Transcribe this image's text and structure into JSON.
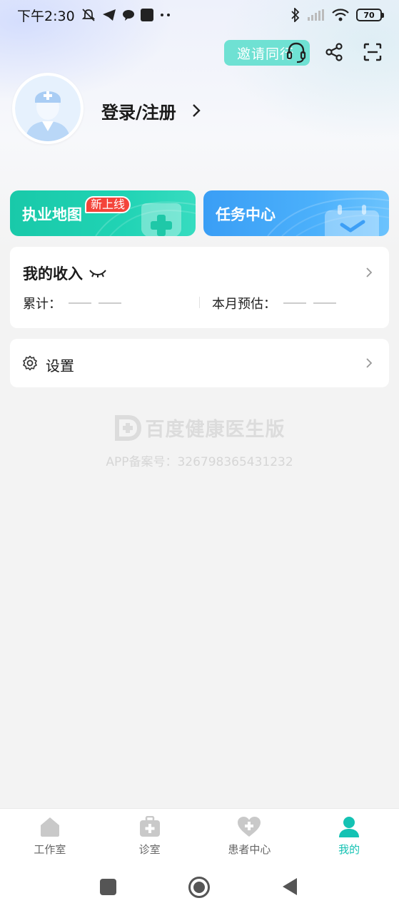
{
  "status_bar": {
    "time": "下午2:30",
    "battery": "70",
    "icons": [
      "mute-icon",
      "telegram-icon",
      "chat-icon",
      "square-icon",
      "dots-icon",
      "bluetooth-icon",
      "signal-icon",
      "wifi-icon",
      "battery-icon"
    ]
  },
  "header": {
    "invite_label": "邀请同行",
    "login_label": "登录/注册"
  },
  "cards": {
    "map_title": "执业地图",
    "map_badge": "新上线",
    "task_title": "任务中心"
  },
  "income": {
    "title": "我的收入",
    "total_label": "累计：",
    "month_label": "本月预估："
  },
  "settings": {
    "label": "设置"
  },
  "watermark": {
    "app_name": "百度健康医生版",
    "record": "APP备案号：326798365431232"
  },
  "tabs": [
    {
      "label": "工作室",
      "icon": "home-icon",
      "active": false
    },
    {
      "label": "诊室",
      "icon": "medical-kit-icon",
      "active": false
    },
    {
      "label": "患者中心",
      "icon": "heart-plus-icon",
      "active": false
    },
    {
      "label": "我的",
      "icon": "person-icon",
      "active": true
    }
  ],
  "colors": {
    "accent": "#14c2b3",
    "map_card": "#20d3b4",
    "task_card": "#4bb0fb",
    "badge": "#f4443a",
    "invite": "#6fe1d3"
  }
}
